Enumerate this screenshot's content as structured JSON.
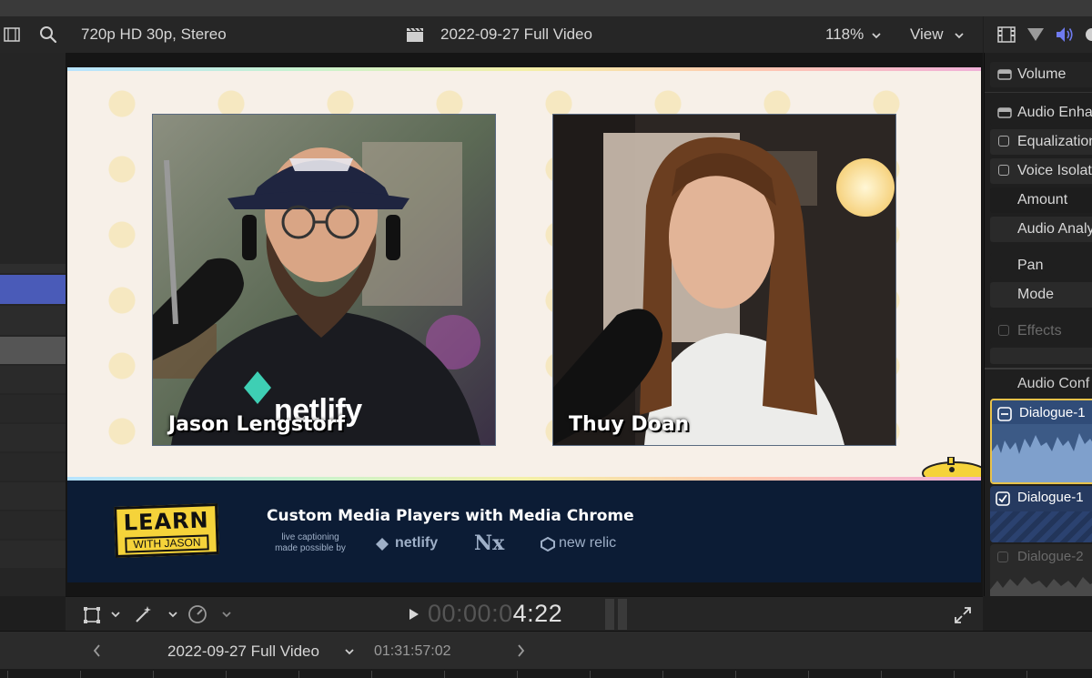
{
  "viewer": {
    "format": "720p HD 30p, Stereo",
    "project_title": "2022-09-27 Full Video",
    "zoom": "118%",
    "view_menu": "View"
  },
  "video": {
    "left_caption": "Jason Lengstorf",
    "right_caption": "Thuy Doan",
    "shirt_text": "netlify",
    "lower_third": {
      "logo_line1": "LEARN",
      "logo_line2": "WITH JASON",
      "title": "Custom Media Players with Media Chrome",
      "caption_line1": "live captioning",
      "caption_line2": "made possible by",
      "sponsors": [
        "netlify",
        "Nx",
        "new relic"
      ]
    }
  },
  "transport": {
    "timecode_dim": "00:00:0",
    "timecode_lit": "4:22"
  },
  "timeline": {
    "project_name": "2022-09-27 Full Video",
    "duration": "01:31:57:02"
  },
  "inspector": {
    "volume": "Volume",
    "audio_enhancements": "Audio Enha",
    "equalization": "Equalization",
    "voice_isolation": "Voice Isolat",
    "amount": "Amount",
    "audio_analysis": "Audio Analy",
    "pan": "Pan",
    "mode": "Mode",
    "effects": "Effects",
    "audio_configuration": "Audio Conf",
    "clips": [
      {
        "label": "Dialogue-1",
        "state": "minus"
      },
      {
        "label": "Dialogue-1",
        "state": "checked"
      },
      {
        "label": "Dialogue-2",
        "state": "unchecked"
      }
    ]
  },
  "colors": {
    "accent_blue": "#4a5bb8",
    "clip_gold": "#e8c24a",
    "navy": "#0c1c35",
    "logo_yellow": "#f5d33a"
  }
}
